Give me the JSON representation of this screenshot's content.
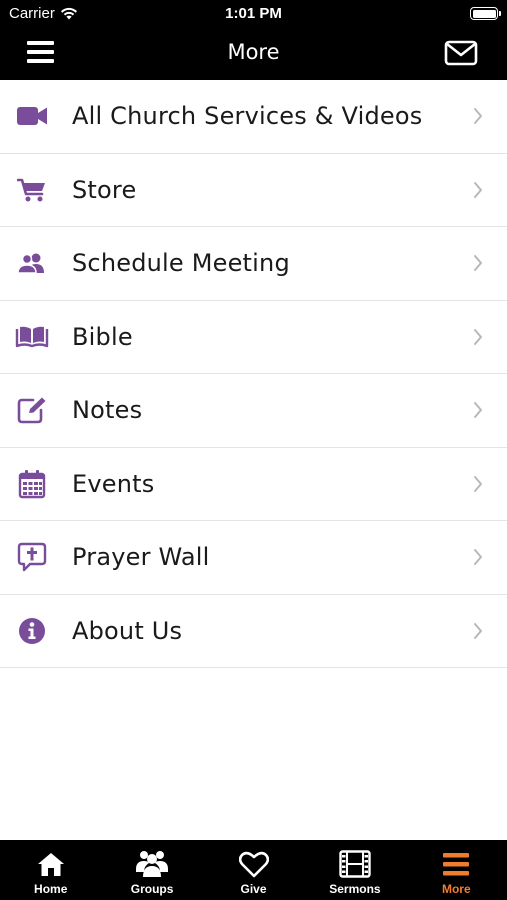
{
  "status_bar": {
    "carrier": "Carrier",
    "time": "1:01 PM"
  },
  "nav": {
    "title": "More",
    "menu_icon": "hamburger-icon",
    "mail_icon": "envelope-icon"
  },
  "accent_color": "#7a4d9a",
  "menu_items": [
    {
      "label": "All Church Services & Videos",
      "icon": "video-camera-icon"
    },
    {
      "label": "Store",
      "icon": "shopping-cart-icon"
    },
    {
      "label": "Schedule Meeting",
      "icon": "people-icon"
    },
    {
      "label": "Bible",
      "icon": "open-book-icon"
    },
    {
      "label": "Notes",
      "icon": "edit-note-icon"
    },
    {
      "label": "Events",
      "icon": "calendar-icon"
    },
    {
      "label": "Prayer Wall",
      "icon": "chat-cross-icon"
    },
    {
      "label": "About Us",
      "icon": "info-icon"
    }
  ],
  "tabs": [
    {
      "label": "Home",
      "icon": "home-icon",
      "active": false
    },
    {
      "label": "Groups",
      "icon": "group-icon",
      "active": false
    },
    {
      "label": "Give",
      "icon": "heart-icon",
      "active": false
    },
    {
      "label": "Sermons",
      "icon": "film-icon",
      "active": false
    },
    {
      "label": "More",
      "icon": "menu-lines-icon",
      "active": true
    }
  ],
  "tab_active_color": "#ef7d2f"
}
